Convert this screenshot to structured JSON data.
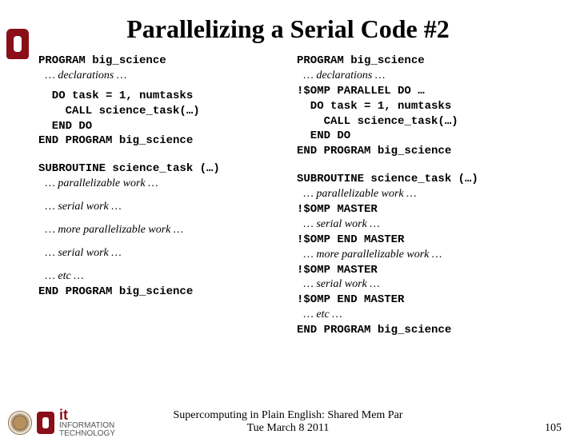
{
  "title": "Parallelizing a Serial Code #2",
  "left": {
    "prog_header": "PROGRAM big_science",
    "decl": "… declarations …",
    "do1": "  DO task = 1, numtasks",
    "do2": "    CALL science_task(…)",
    "do3": "  END DO",
    "prog_end": "END PROGRAM big_science",
    "sub_header": "SUBROUTINE science_task (…)",
    "pw": "… parallelizable work …",
    "sw1": "… serial work …",
    "mpw": "… more parallelizable work …",
    "sw2": "… serial work …",
    "etc": "… etc …",
    "sub_end": "END PROGRAM big_science"
  },
  "right": {
    "prog_header": "PROGRAM big_science",
    "decl": "… declarations …",
    "omp_par": "!$OMP PARALLEL DO …",
    "do1": "  DO task = 1, numtasks",
    "do2": "    CALL science_task(…)",
    "do3": "  END DO",
    "prog_end": "END PROGRAM big_science",
    "sub_header": "SUBROUTINE science_task (…)",
    "pw": "… parallelizable work …",
    "omp_m1": "!$OMP MASTER",
    "sw1": "… serial work …",
    "omp_em1": "!$OMP END MASTER",
    "mpw": "… more parallelizable work …",
    "omp_m2": "!$OMP MASTER",
    "sw2": "… serial work …",
    "omp_em2": "!$OMP END MASTER",
    "etc": "… etc …",
    "sub_end": "END PROGRAM big_science"
  },
  "footer_line1": "Supercomputing in Plain English: Shared Mem Par",
  "footer_line2": "Tue March 8 2011",
  "page_number": "105",
  "logos": {
    "top": "ou-logo",
    "bottom": [
      "oscer-seal",
      "ou-logo-small",
      "it-information-technology"
    ]
  }
}
